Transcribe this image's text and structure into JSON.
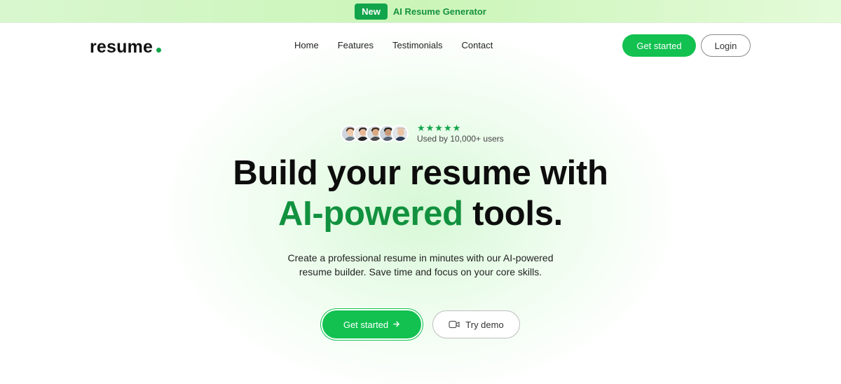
{
  "announcement": {
    "badge": "New",
    "text": "AI Resume Generator"
  },
  "nav": {
    "logo": "resume",
    "links": [
      "Home",
      "Features",
      "Testimonials",
      "Contact"
    ],
    "get_started": "Get started",
    "login": "Login"
  },
  "hero": {
    "stars": "★★★★★",
    "rating_count": 5,
    "users_text": "Used by 10,000+ users",
    "headline_line1": "Build your resume with",
    "headline_accent": "AI-powered",
    "headline_rest": "tools.",
    "subtext": "Create a professional resume in minutes with our AI-powered resume builder. Save time and focus on your core skills.",
    "cta_primary": "Get started",
    "cta_primary_icon": "arrow-right-icon",
    "cta_secondary": "Try demo",
    "cta_secondary_icon": "video-camera-icon"
  },
  "colors": {
    "brand_green": "#12c150",
    "accent_text_green": "#12913f",
    "announcement_bg": "#cbf5b8"
  }
}
